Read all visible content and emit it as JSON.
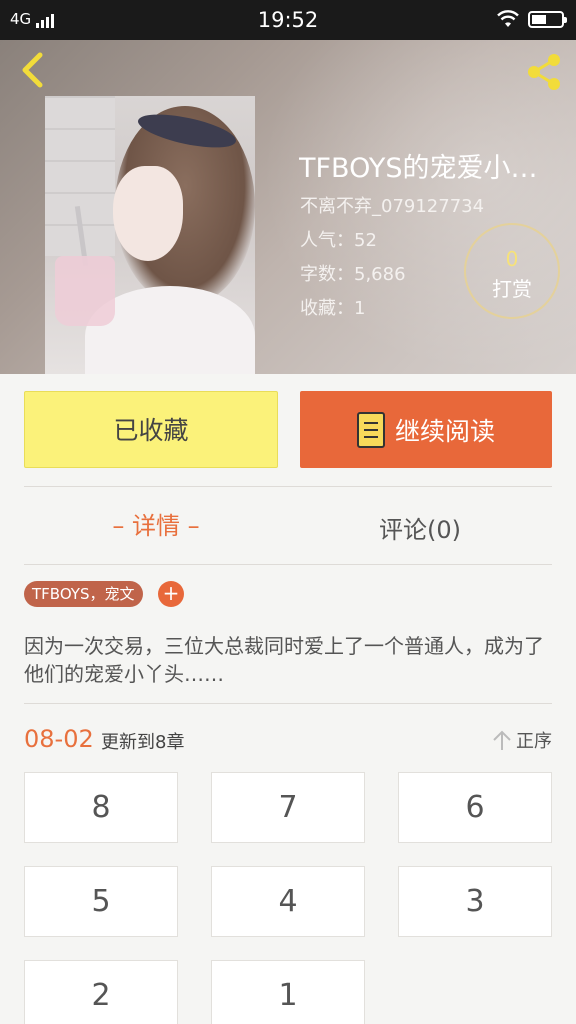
{
  "status_bar": {
    "network": "4G",
    "time": "19:52"
  },
  "book": {
    "title": "TFBOYS的宠爱小…",
    "author": "不离不弃_079127734",
    "popularity_label": "人气：52",
    "word_count_label": "字数：5,686",
    "favorites_label": "收藏：1",
    "reward_count": "0",
    "reward_label": "打赏"
  },
  "actions": {
    "saved_label": "已收藏",
    "read_label": "继续阅读"
  },
  "tabs": {
    "detail": "– 详情 –",
    "comments": "评论(0)"
  },
  "tags": {
    "label": "TFBOYS，宠文",
    "add": "+"
  },
  "summary": "因为一次交易，三位大总裁同时爱上了一个普通人，成为了他们的宠爱小丫头……",
  "chapters": {
    "date": "08-02",
    "update_text": "更新到8章",
    "sort_label": "正序",
    "items": [
      "8",
      "7",
      "6",
      "5",
      "4",
      "3",
      "2",
      "1"
    ]
  },
  "colors": {
    "accent": "#e8683a",
    "saved_bg": "#fbf27a",
    "tag_bg": "#c0644a"
  },
  "icons": [
    "back-chevron-icon",
    "share-icon",
    "book-icon",
    "sort-arrow-icon"
  ]
}
